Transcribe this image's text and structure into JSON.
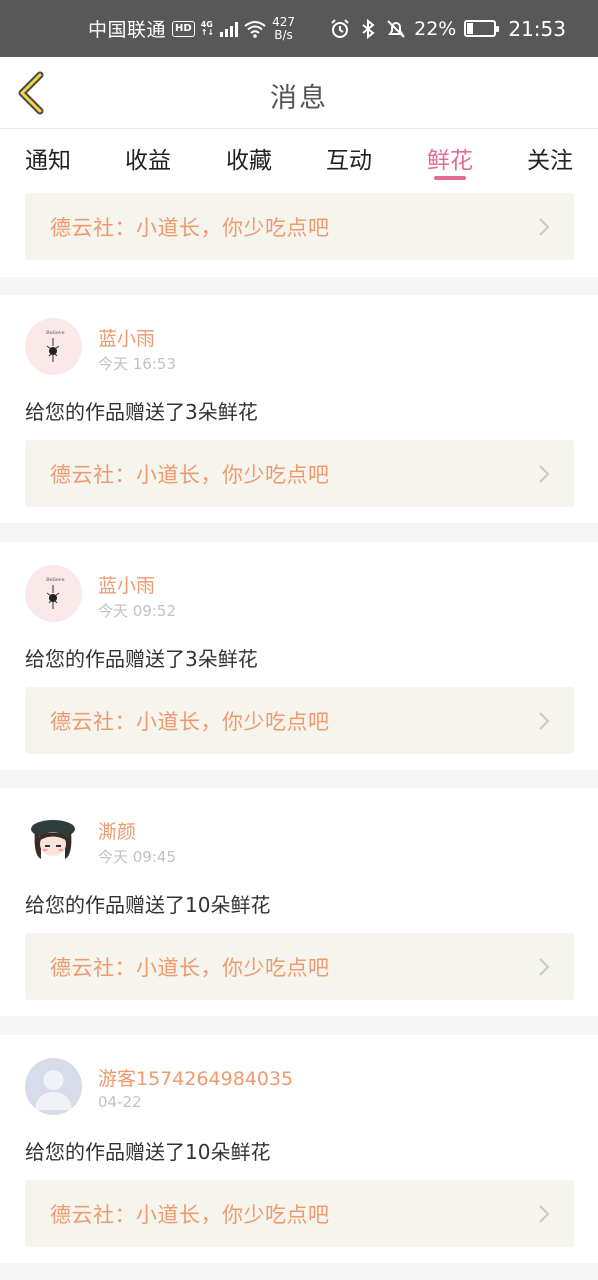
{
  "status_bar": {
    "carrier": "中国联通",
    "hd": "HD",
    "network": "4G",
    "speed_value": "427",
    "speed_unit": "B/s",
    "battery": "22%",
    "time": "21:53"
  },
  "header": {
    "title": "消息"
  },
  "tabs": [
    {
      "label": "通知"
    },
    {
      "label": "收益"
    },
    {
      "label": "收藏"
    },
    {
      "label": "互动"
    },
    {
      "label": "鲜花",
      "active": true
    },
    {
      "label": "关注"
    }
  ],
  "feed": {
    "partial_top": {
      "work_title": "德云社：小道长，你少吃点吧"
    },
    "items": [
      {
        "username": "蓝小雨",
        "time": "今天 16:53",
        "message": "给您的作品赠送了3朵鲜花",
        "work_title": "德云社：小道长，你少吃点吧",
        "avatar": "sketch-avatar"
      },
      {
        "username": "蓝小雨",
        "time": "今天 09:52",
        "message": "给您的作品赠送了3朵鲜花",
        "work_title": "德云社：小道长，你少吃点吧",
        "avatar": "sketch-avatar"
      },
      {
        "username": "澌颜",
        "time": "今天 09:45",
        "message": "给您的作品赠送了10朵鲜花",
        "work_title": "德云社：小道长，你少吃点吧",
        "avatar": "anime-girl-avatar"
      },
      {
        "username": "游客1574264984035",
        "time": "04-22",
        "message": "给您的作品赠送了10朵鲜花",
        "work_title": "德云社：小道长，你少吃点吧",
        "avatar": "default-user-avatar"
      }
    ]
  },
  "colors": {
    "accent": "#e56b99",
    "orange_text": "#ef9a6e",
    "link_bg": "#f5f5ee",
    "status_bar": "#585858"
  }
}
